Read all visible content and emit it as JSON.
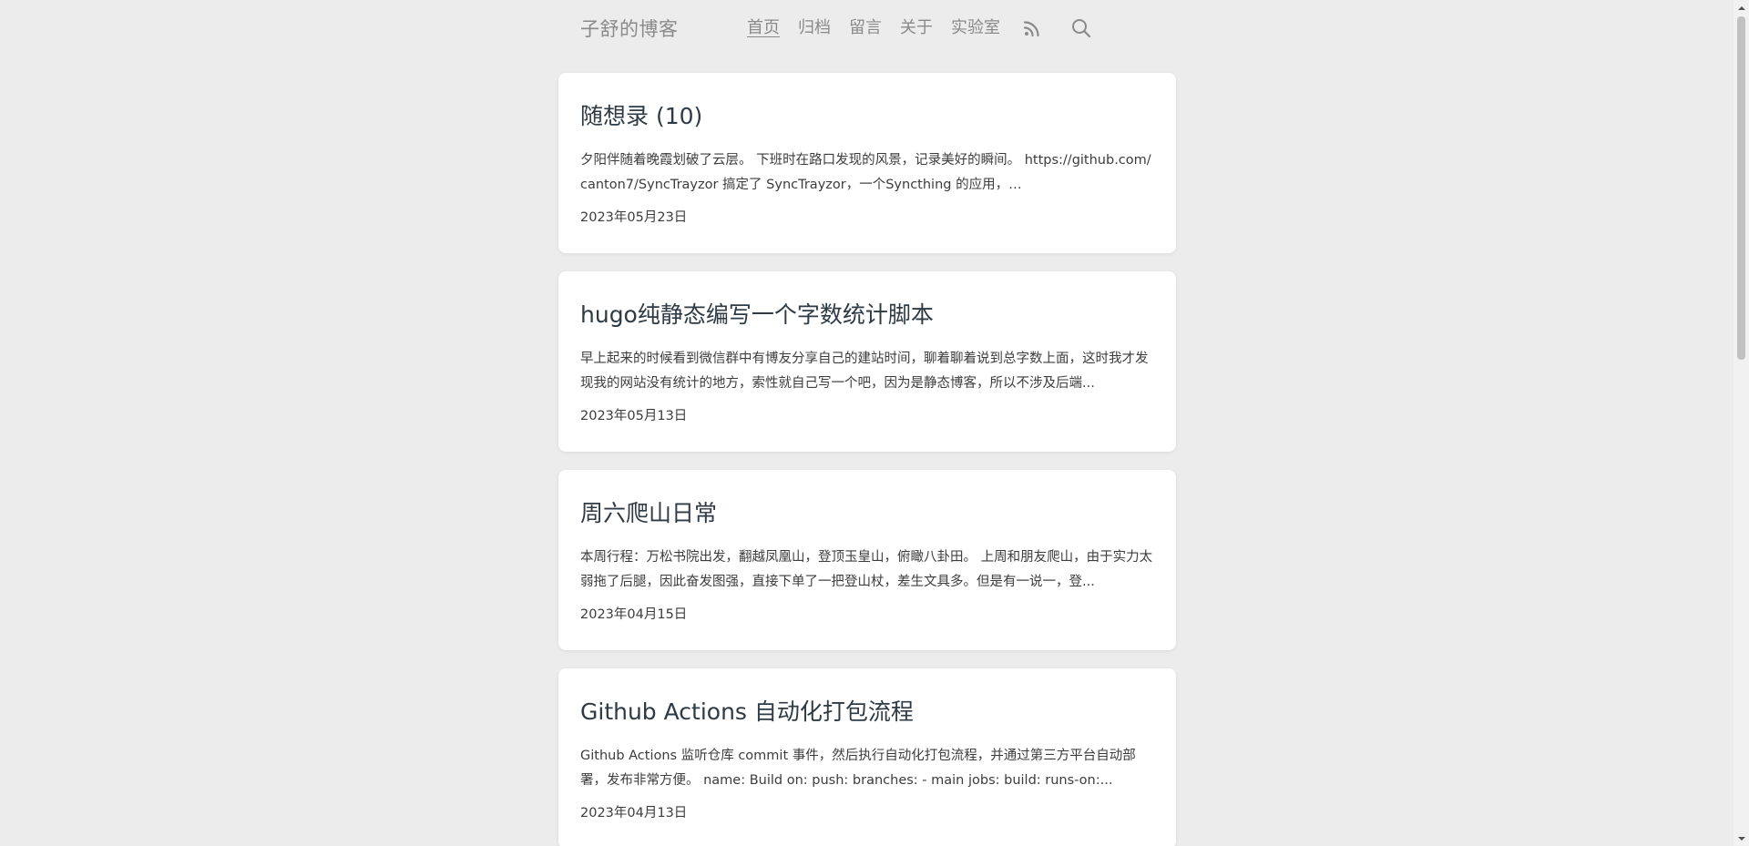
{
  "site": {
    "title": "子舒的博客"
  },
  "nav": {
    "items": [
      {
        "label": "首页",
        "active": true
      },
      {
        "label": "归档",
        "active": false
      },
      {
        "label": "留言",
        "active": false
      },
      {
        "label": "关于",
        "active": false
      },
      {
        "label": "实验室",
        "active": false
      }
    ],
    "icons": [
      "rss-icon",
      "search-icon"
    ]
  },
  "posts": [
    {
      "title": "随想录 (10)",
      "summary": "夕阳伴随着晚霞划破了云层。 下班时在路口发现的风景，记录美好的瞬间。 https://github.com/canton7/SyncTrayzor 搞定了 SyncTrayzor，一个Syncthing 的应用，…",
      "date": "2023年05月23日"
    },
    {
      "title": "hugo纯静态编写一个字数统计脚本",
      "summary": "早上起来的时候看到微信群中有博友分享自己的建站时间，聊着聊着说到总字数上面，这时我才发现我的网站没有统计的地方，索性就自己写一个吧，因为是静态博客，所以不涉及后端...",
      "date": "2023年05月13日"
    },
    {
      "title": "周六爬山日常",
      "summary": "本周行程：万松书院出发，翻越凤凰山，登顶玉皇山，俯瞰八卦田。 上周和朋友爬山，由于实力太弱拖了后腿，因此奋发图强，直接下单了一把登山杖，差生文具多。但是有一说一，登...",
      "date": "2023年04月15日"
    },
    {
      "title": "Github Actions 自动化打包流程",
      "summary": "Github Actions 监听仓库 commit 事件，然后执行自动化打包流程，并通过第三方平台自动部署，发布非常方便。 name: Build on: push: branches: - main jobs: build: runs-on:...",
      "date": "2023年04月13日"
    }
  ],
  "colors": {
    "background": "#ececec",
    "card": "#ffffff",
    "nav_text": "#8a8a8a",
    "title_text": "#2e3a44"
  }
}
